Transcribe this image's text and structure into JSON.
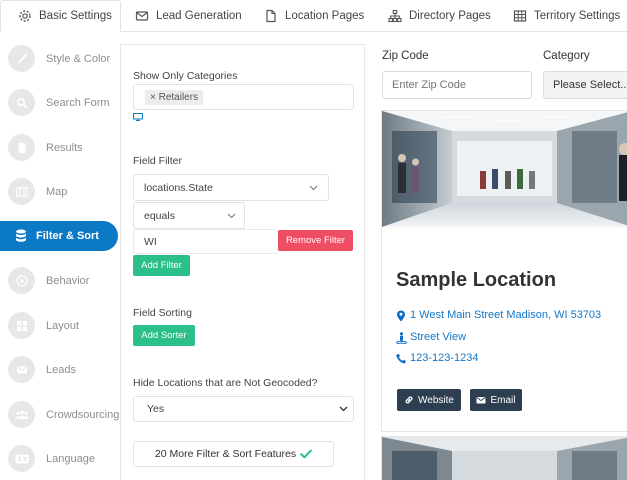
{
  "tabs": [
    {
      "label": "Basic Settings",
      "icon": "gear-icon"
    },
    {
      "label": "Lead Generation",
      "icon": "envelope-icon"
    },
    {
      "label": "Location Pages",
      "icon": "file-icon"
    },
    {
      "label": "Directory Pages",
      "icon": "sitemap-icon"
    },
    {
      "label": "Territory Settings",
      "icon": "table-icon"
    }
  ],
  "sidebar": {
    "active_index": 4,
    "items": [
      {
        "label": "Style & Color",
        "icon": "brush-icon"
      },
      {
        "label": "Search Form",
        "icon": "search-icon"
      },
      {
        "label": "Results",
        "icon": "file-icon"
      },
      {
        "label": "Map",
        "icon": "map-icon"
      },
      {
        "label": "Filter & Sort",
        "icon": "database-icon"
      },
      {
        "label": "Behavior",
        "icon": "play-icon"
      },
      {
        "label": "Layout",
        "icon": "grid-icon"
      },
      {
        "label": "Leads",
        "icon": "envelope-icon"
      },
      {
        "label": "Crowdsourcing",
        "icon": "users-icon"
      },
      {
        "label": "Language",
        "icon": "language-icon"
      }
    ]
  },
  "settings": {
    "categories_label": "Show Only Categories",
    "category_tag": "× Retailers",
    "field_filter_label": "Field Filter",
    "field_value": "locations.State",
    "operator_value": "equals",
    "filter_value": "WI",
    "remove_filter": "Remove Filter",
    "add_filter": "Add Filter",
    "field_sorting_label": "Field Sorting",
    "add_sorter": "Add Sorter",
    "geocode_label": "Hide Locations that are Not Geocoded?",
    "geocode_value": "Yes",
    "more_features": "20 More Filter & Sort Features"
  },
  "preview": {
    "zip_label": "Zip Code",
    "zip_placeholder": "Enter Zip Code",
    "category_label": "Category",
    "category_value": "Please Select...",
    "location_title": "Sample Location",
    "address": "1 West Main Street Madison, WI 53703",
    "street_view": "Street View",
    "phone": "123-123-1234",
    "website_button": "Website",
    "email_button": "Email"
  },
  "colors": {
    "accent_blue": "#0c79c4",
    "green": "#2bbf8a",
    "red": "#ef4d63",
    "dark_button": "#2d3e50",
    "link": "#1277c9"
  }
}
